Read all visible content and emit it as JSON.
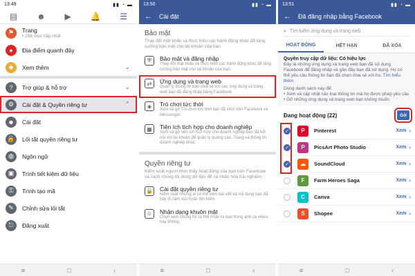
{
  "panel1": {
    "time": "13:49",
    "items": [
      {
        "label": "Trang",
        "sub": "• 256 mục cập nhật",
        "color": "#e4572e",
        "icon": "⚑"
      },
      {
        "label": "Địa điểm quanh đây",
        "sub": "",
        "color": "#e02424",
        "icon": "●"
      },
      {
        "label": "Xem thêm",
        "sub": "",
        "color": "#f0a830",
        "icon": "◆"
      }
    ],
    "help": "Trợ giúp & hỗ trợ",
    "settings_privacy": "Cài đặt & Quyền riêng tư",
    "sub_items": [
      "Cài đặt",
      "Lối tắt quyền riêng tư",
      "Ngôn ngữ",
      "Trình tiết kiệm dữ liệu",
      "Trình tạo mã",
      "Chỉnh sửa lối tắt",
      "Đăng xuất"
    ]
  },
  "panel2": {
    "time": "13:50",
    "header": "Cài đặt",
    "security_title": "Bảo mật",
    "security_desc": "Thay đổi mật khẩu và thực hiện các hành động khác để tăng cường bảo mật cho tài khoản của bạn.",
    "rows": [
      {
        "title": "Bảo mật và đăng nhập",
        "desc": "Thay đổi mật khẩu và thực hiện các hành động khác để tăng cường bảo mật cho tài khoản của bạn."
      },
      {
        "title": "Ứng dụng và trang web",
        "desc": "Quản lý thông tin bạn chia sẻ với các ứng dụng và trang web bạn đã đăng nhập bằng Facebook."
      },
      {
        "title": "Trò chơi tức thời",
        "desc": "Xem và gỡ Trò chơi tức thời bạn đã chơi trên Facebook và Messenger."
      },
      {
        "title": "Tiện ích tích hợp cho doanh nghiệp",
        "desc": "Xem và gỡ tiện ích tích hợp cho doanh nghiệp bạn đã kết nối với tài khoản để quản lý quảng cáo, Trang và thông tin doanh nghiệp khác."
      }
    ],
    "privacy_title": "Quyền riêng tư",
    "privacy_desc": "Kiểm soát người nhìn thấy hoạt động của bạn trên Facebook và cách chúng tôi dùng dữ liệu để cá nhân hóa trải nghiệm.",
    "privacy_rows": [
      {
        "title": "Cài đặt quyền riêng tư",
        "desc": "Kiểm soát những ai có thể xem bài viết và nội dung bạn đã bày tỏ cảm xúc hoặc tìm kiếm."
      },
      {
        "title": "Nhận dạng khuôn mặt",
        "desc": "Chọn xem chúng tôi có thể nhận ra bạn trong ảnh và video hay không."
      }
    ]
  },
  "panel3": {
    "time": "13:51",
    "header": "Đã đăng nhập bằng Facebook",
    "search_placeholder": "Tìm kiếm ứng dụng và trang web",
    "tabs": [
      "HOẠT ĐỘNG",
      "HẾT HẠN",
      "ĐÃ XÓA"
    ],
    "info_title": "Quyền truy cập dữ liệu: Có hiệu lực",
    "info_text": "Đây là những ứng dụng và trang web bạn đã sử dụng Facebook để đăng nhập và gần đây bạn đã sử dụng. Họ có thể yêu cầu thông tin bạn đã chọn chia sẻ với họ.",
    "info_link": "Tìm hiểu thêm.",
    "info_extra1": "Dùng danh sách này để:",
    "info_extra2": "• Xem và cập nhật các loại thông tin mà họ được phép yêu cầu",
    "info_extra3": "• Gỡ những ứng dụng và trang web bạn không muốn",
    "active_label": "Đang hoạt động (22)",
    "go_label": "Gỡ",
    "view_label": "Xem",
    "apps": [
      {
        "name": "Pinterest",
        "checked": true,
        "color": "#e60023",
        "glyph": "P"
      },
      {
        "name": "PicsArt Photo Studio",
        "checked": true,
        "color": "#c13584",
        "glyph": "P"
      },
      {
        "name": "SoundCloud",
        "checked": true,
        "color": "#ff5500",
        "glyph": "☁"
      },
      {
        "name": "Farm Heroes Saga",
        "checked": false,
        "color": "#5b9b3b",
        "glyph": "F"
      },
      {
        "name": "Canva",
        "checked": false,
        "color": "#00c4cc",
        "glyph": "C"
      },
      {
        "name": "Shopee",
        "checked": false,
        "color": "#ee4d2d",
        "glyph": "S"
      }
    ]
  }
}
